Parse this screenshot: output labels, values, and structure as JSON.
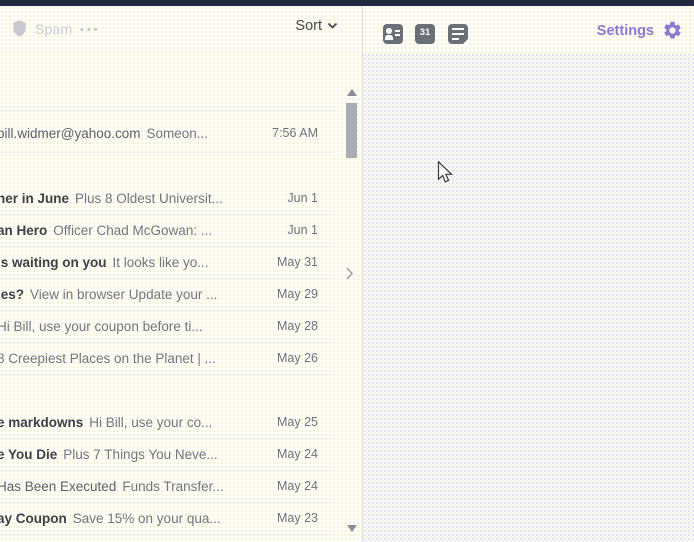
{
  "colors": {
    "accent_purple": "#8a7ad0",
    "topbar_dark": "#232840",
    "reading_pane_gray": "#f4f4f6"
  },
  "toolbar": {
    "spam_label": "Spam",
    "more_label": "•••",
    "sort_label": "Sort"
  },
  "app_header": {
    "icons": [
      "contacts-icon",
      "calendar-icon",
      "notepad-icon"
    ],
    "calendar_day": "31",
    "settings_label": "Settings"
  },
  "email_list": {
    "rows": [
      {
        "primary": "bill.widmer@yahoo.com",
        "bold": false,
        "snippet": "Someon...",
        "date": "7:56 AM"
      },
      {
        "primary": "her in June",
        "bold": true,
        "snippet": "Plus 8 Oldest Universit...",
        "date": "Jun 1"
      },
      {
        "primary": "an Hero",
        "bold": true,
        "snippet": "Officer Chad McGowan: ...",
        "date": "Jun 1"
      },
      {
        "primary": "is waiting on you",
        "bold": true,
        "snippet": "It looks like yo...",
        "date": "May 31"
      },
      {
        "primary": "ies?",
        "bold": true,
        "snippet": "View in browser Update your ...",
        "date": "May 29"
      },
      {
        "primary": "",
        "bold": false,
        "snippet": "Hi Bill, use your coupon before ti...",
        "date": "May 28"
      },
      {
        "primary": "",
        "bold": false,
        "snippet": "8 Creepiest Places on the Planet | ...",
        "date": "May 26"
      },
      {
        "primary": "e markdowns",
        "bold": true,
        "snippet": "Hi Bill, use your co...",
        "date": "May 25"
      },
      {
        "primary": "e You Die",
        "bold": true,
        "snippet": "Plus 7 Things You Neve...",
        "date": "May 24"
      },
      {
        "primary": "Has Been Executed",
        "bold": false,
        "snippet": "Funds Transfer...",
        "date": "May 24"
      },
      {
        "primary": "ay Coupon",
        "bold": true,
        "snippet": "Save 15% on your qua...",
        "date": "May 23"
      }
    ]
  }
}
